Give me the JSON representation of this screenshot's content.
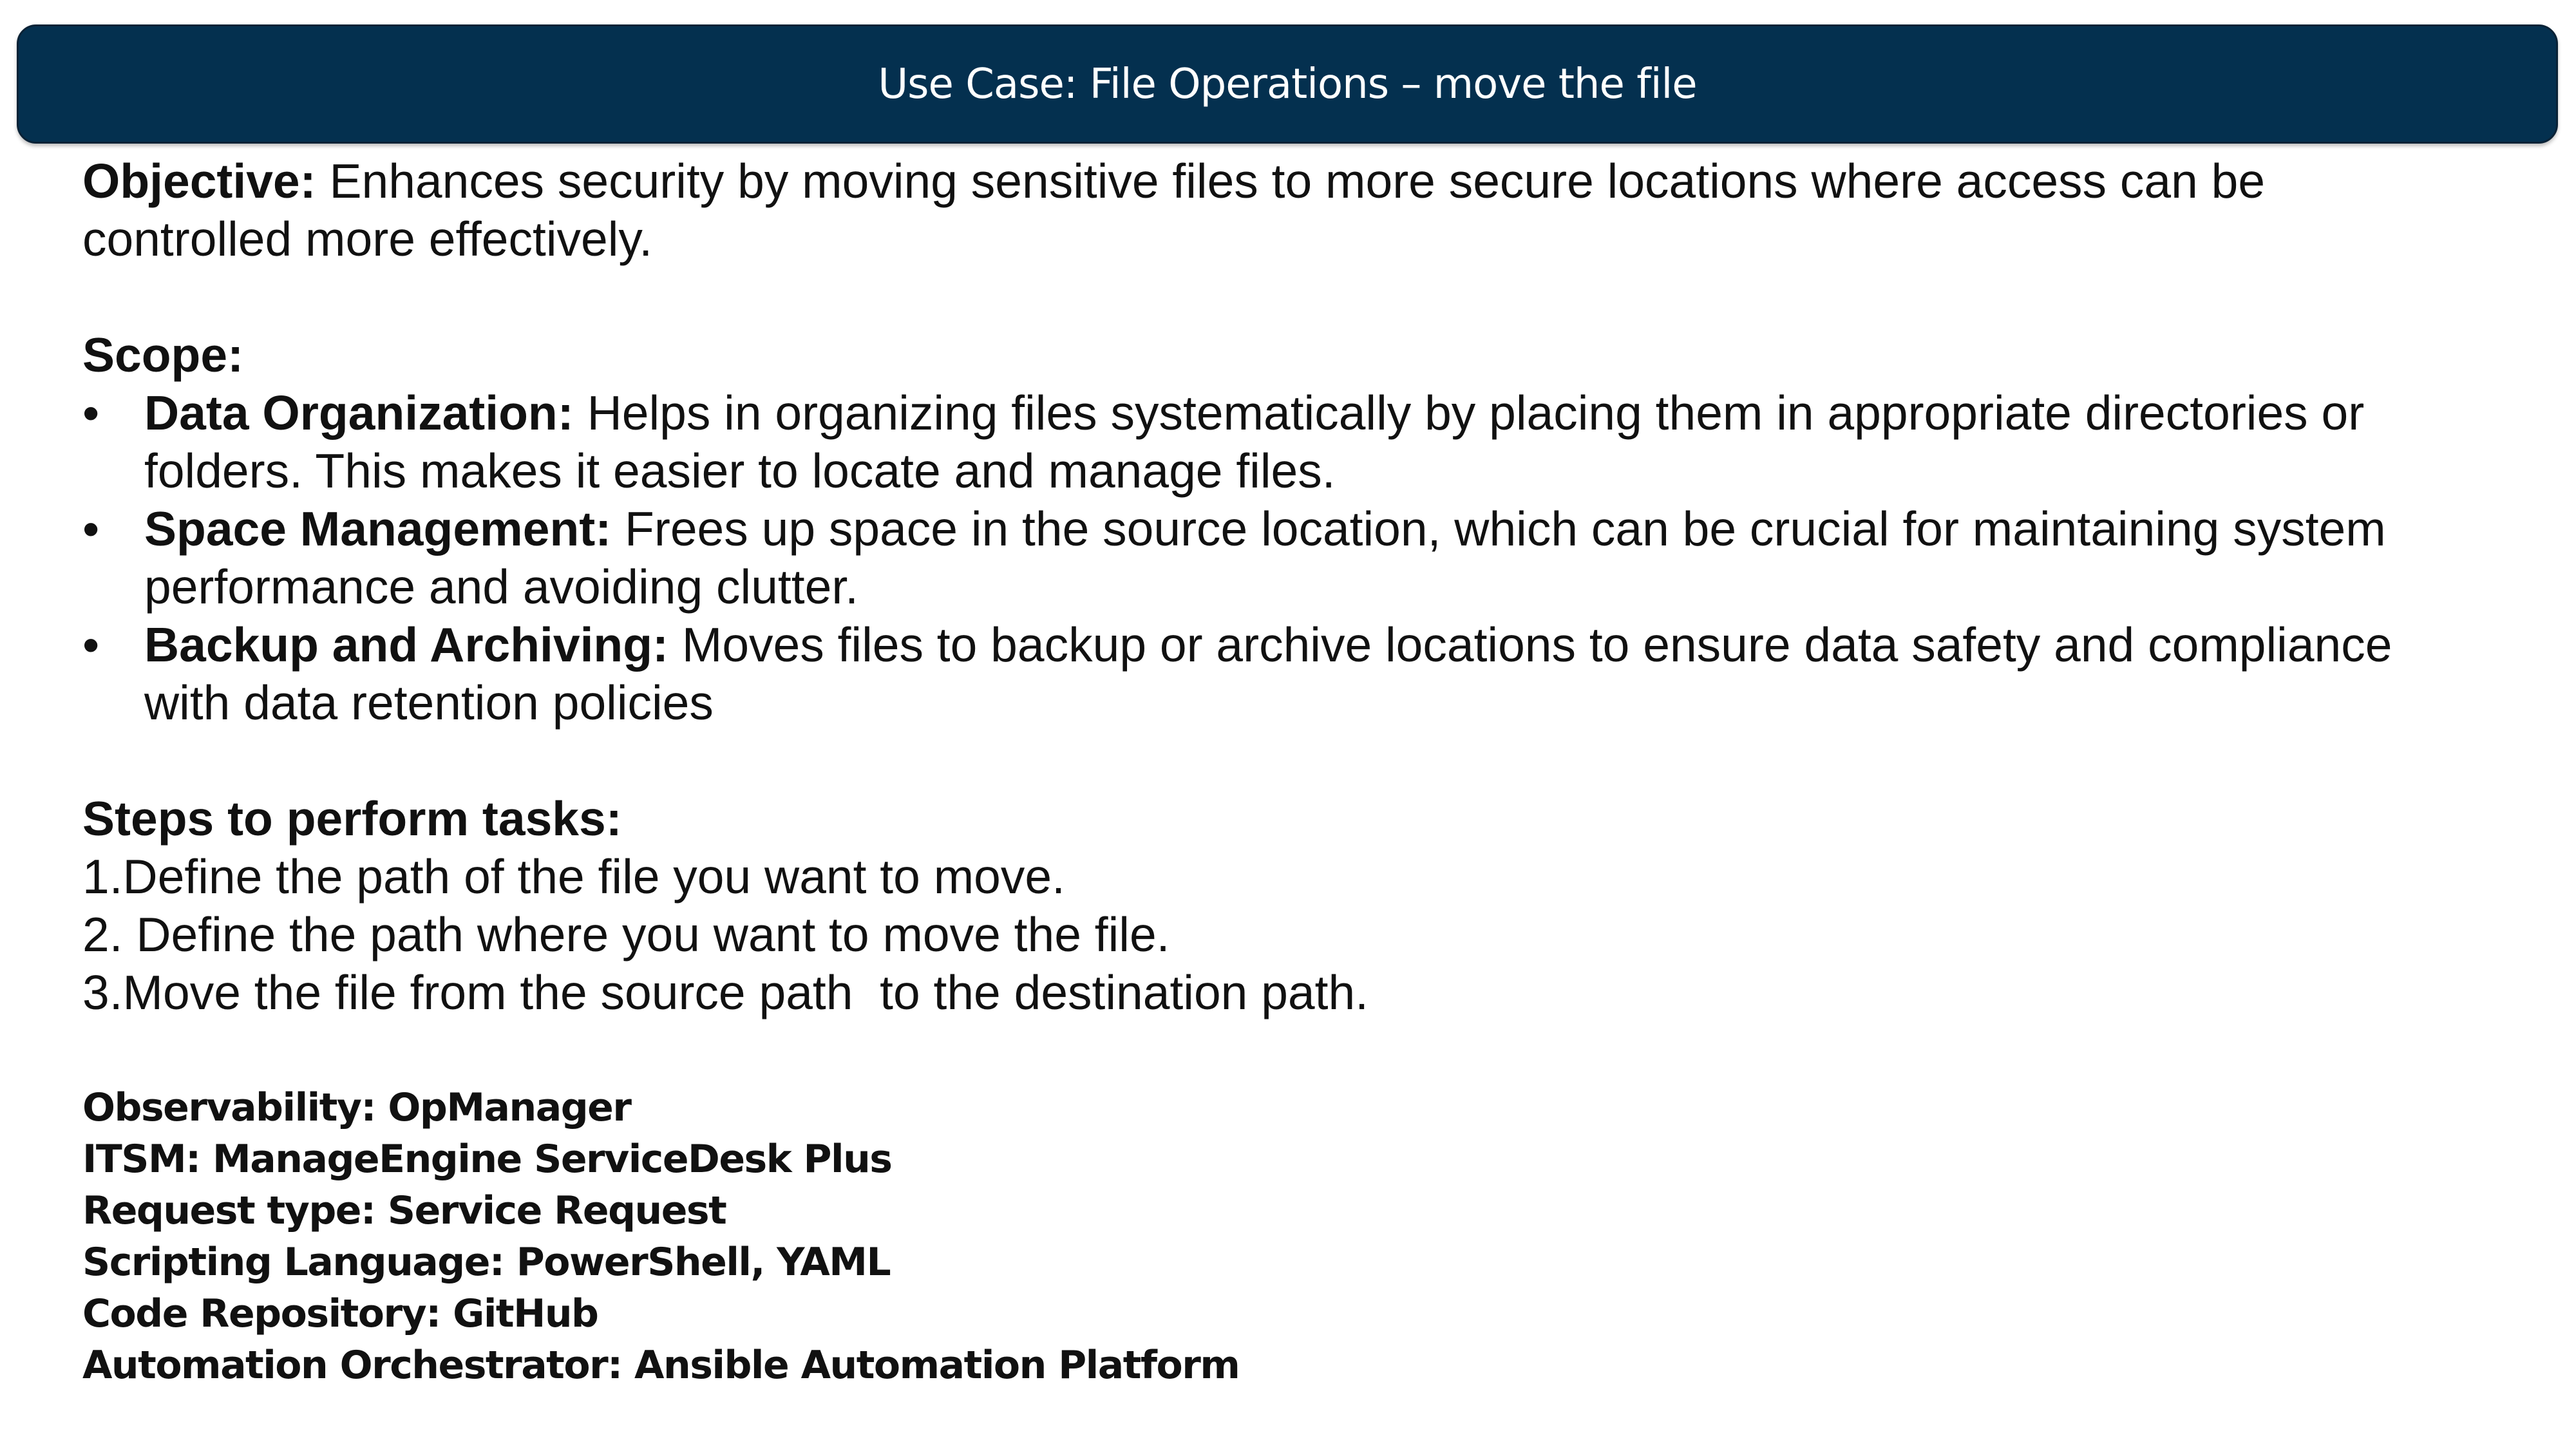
{
  "header": {
    "title": "Use Case: File Operations – move the file",
    "bg_color": "#04304f"
  },
  "objective": {
    "label": "Objective:",
    "text": " Enhances security by moving sensitive files to more secure locations where access can be controlled more effectively."
  },
  "scope": {
    "heading": "Scope:",
    "items": [
      {
        "bullet": "•",
        "label": "Data Organization:",
        "text": " Helps in organizing files systematically by placing them in appropriate directories or folders. This makes it easier to locate and manage files."
      },
      {
        "bullet": "•",
        "label": "Space Management:",
        "text": " Frees up space in the source location, which can be crucial for maintaining system performance and avoiding clutter."
      },
      {
        "bullet": "•",
        "label": "Backup and Archiving:",
        "text": " Moves files to backup or archive locations to ensure data safety and compliance with data retention policies"
      }
    ]
  },
  "steps": {
    "heading": "Steps to perform tasks:",
    "items": [
      "1.Define the path of the file you want to move.",
      "2. Define the path where you want to move the file.",
      "3.Move the file from the source path  to the destination path."
    ]
  },
  "meta": [
    "Observability: OpManager",
    "ITSM: ManageEngine ServiceDesk Plus",
    "Request type: Service Request",
    "Scripting Language: PowerShell, YAML",
    "Code Repository: GitHub",
    "Automation Orchestrator: Ansible Automation Platform"
  ]
}
